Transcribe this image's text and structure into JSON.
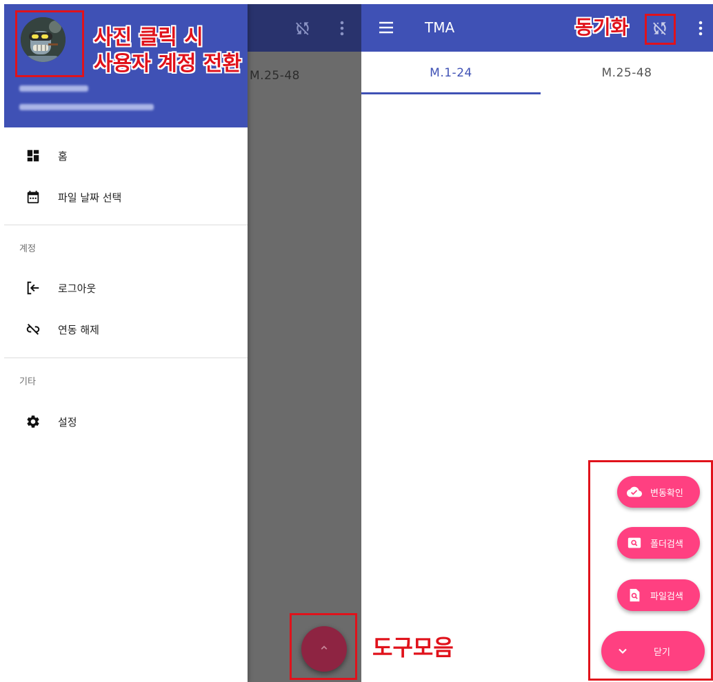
{
  "drawer": {
    "user_name": "",
    "user_email": "",
    "items": [
      {
        "icon": "dashboard-icon",
        "label": "홈"
      },
      {
        "icon": "calendar-icon",
        "label": "파일 날짜 선택"
      }
    ],
    "sections": [
      {
        "label": "계정",
        "items": [
          {
            "icon": "logout-icon",
            "label": "로그아웃"
          },
          {
            "icon": "link-off-icon",
            "label": "연동 해제"
          }
        ]
      },
      {
        "label": "기타",
        "items": [
          {
            "icon": "settings-gear-icon",
            "label": "설정"
          }
        ]
      }
    ]
  },
  "left_screen": {
    "tab_label": "M.25-48"
  },
  "app": {
    "title": "TMA"
  },
  "tabs": [
    {
      "label": "M.1-24"
    },
    {
      "label": "M.25-48"
    }
  ],
  "fab_menu": [
    {
      "icon": "cloud-check-icon",
      "label": "변동확인"
    },
    {
      "icon": "folder-search-icon",
      "label": "폴더검색"
    },
    {
      "icon": "file-search-icon",
      "label": "파일검색"
    },
    {
      "icon": "chevron-down-icon",
      "label": "닫기"
    }
  ],
  "annotations": {
    "avatar_line1": "사진 클릭 시",
    "avatar_line2": "사용자 계정 전환",
    "sync": "동기화",
    "toolbar": "도구모음"
  },
  "colors": {
    "primary": "#3f51b5",
    "accent": "#ff4081",
    "annotation_red": "#e0121b"
  }
}
